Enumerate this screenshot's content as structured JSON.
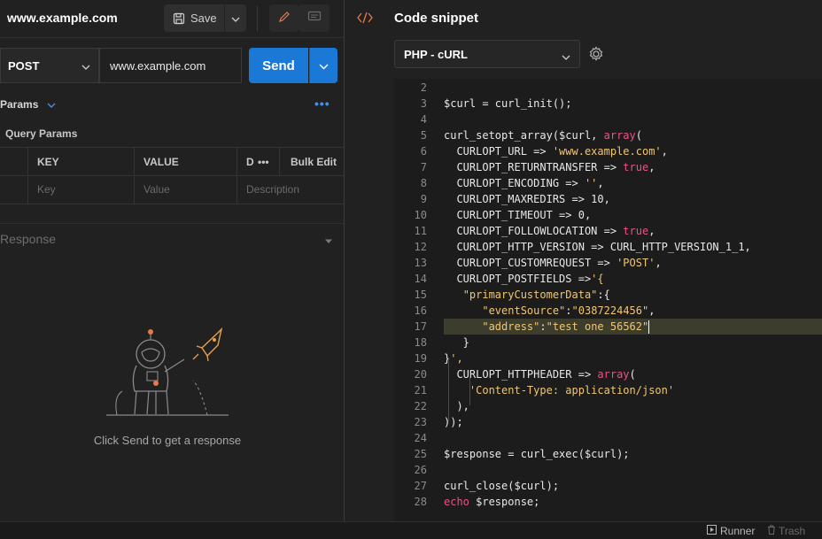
{
  "request": {
    "title": "www.example.com",
    "save_label": "Save",
    "method": "POST",
    "url": "www.example.com",
    "send_label": "Send"
  },
  "params": {
    "tab_label": "Params",
    "section_title": "Query Params",
    "headers": {
      "key": "KEY",
      "value": "VALUE",
      "description_partial": "D",
      "bulk_edit": "Bulk Edit"
    },
    "placeholders": {
      "key": "Key",
      "value": "Value",
      "description": "Description"
    }
  },
  "response": {
    "title": "Response",
    "empty_message": "Click Send to get a response"
  },
  "snippet": {
    "title": "Code snippet",
    "language": "PHP - cURL"
  },
  "code_lines": [
    {
      "n": "2",
      "text": ""
    },
    {
      "n": "3",
      "text": "$curl = curl_init();"
    },
    {
      "n": "4",
      "text": ""
    },
    {
      "n": "5",
      "text": "curl_setopt_array($curl, array("
    },
    {
      "n": "6",
      "text": "  CURLOPT_URL => 'www.example.com',"
    },
    {
      "n": "7",
      "text": "  CURLOPT_RETURNTRANSFER => true,"
    },
    {
      "n": "8",
      "text": "  CURLOPT_ENCODING => '',"
    },
    {
      "n": "9",
      "text": "  CURLOPT_MAXREDIRS => 10,"
    },
    {
      "n": "10",
      "text": "  CURLOPT_TIMEOUT => 0,"
    },
    {
      "n": "11",
      "text": "  CURLOPT_FOLLOWLOCATION => true,"
    },
    {
      "n": "12",
      "text": "  CURLOPT_HTTP_VERSION => CURL_HTTP_VERSION_1_1,"
    },
    {
      "n": "13",
      "text": "  CURLOPT_CUSTOMREQUEST => 'POST',"
    },
    {
      "n": "14",
      "text": "  CURLOPT_POSTFIELDS =>'{"
    },
    {
      "n": "15",
      "text": "   \"primaryCustomerData\":{"
    },
    {
      "n": "16",
      "text": "      \"eventSource\":\"0387224456\","
    },
    {
      "n": "17",
      "text": "      \"address\":\"test one 56562\""
    },
    {
      "n": "18",
      "text": "   }"
    },
    {
      "n": "19",
      "text": "}',"
    },
    {
      "n": "20",
      "text": "  CURLOPT_HTTPHEADER => array("
    },
    {
      "n": "21",
      "text": "    'Content-Type: application/json'"
    },
    {
      "n": "22",
      "text": "  ),"
    },
    {
      "n": "23",
      "text": "));"
    },
    {
      "n": "24",
      "text": ""
    },
    {
      "n": "25",
      "text": "$response = curl_exec($curl);"
    },
    {
      "n": "26",
      "text": ""
    },
    {
      "n": "27",
      "text": "curl_close($curl);"
    },
    {
      "n": "28",
      "text": "echo $response;"
    }
  ],
  "footer": {
    "runner_label": "Runner",
    "trash_label": "Trash"
  },
  "icons": [
    "save-icon",
    "chevron-down-icon",
    "pencil-icon",
    "comment-icon",
    "code-icon",
    "gear-icon",
    "more-dots-icon",
    "astronaut-illustration",
    "play-icon",
    "trash-icon"
  ],
  "colors": {
    "send_blue": "#1a78d6",
    "string_yellow": "#f0c674",
    "keyword_pink": "#e75480",
    "accent_orange": "#e8784a"
  }
}
